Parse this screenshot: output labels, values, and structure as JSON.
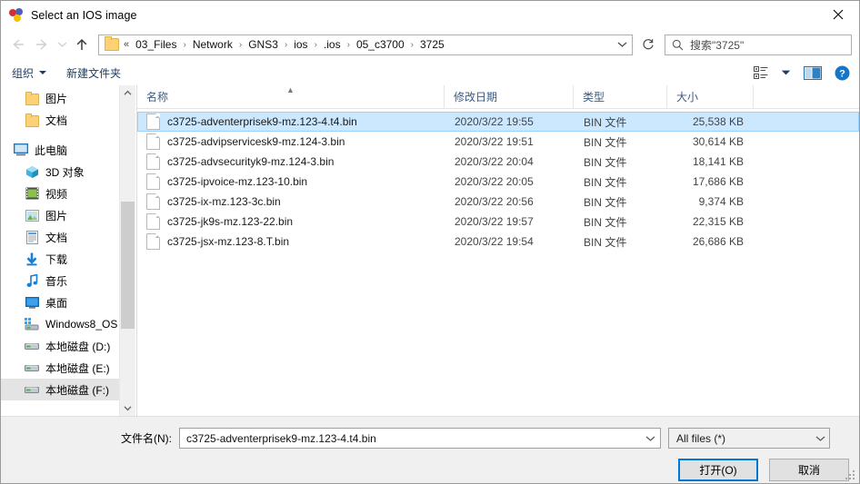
{
  "window": {
    "title": "Select an IOS image",
    "icon": "gns3-balls-icon",
    "close_label": "✕"
  },
  "nav": {
    "back_icon": "arrow-left-icon",
    "forward_icon": "arrow-right-icon",
    "recent_icon": "chevron-down-icon",
    "up_icon": "arrow-up-icon",
    "refresh_icon": "refresh-icon",
    "breadcrumb_prefix": "«",
    "breadcrumb": [
      "03_Files",
      "Network",
      "GNS3",
      "ios",
      ".ios",
      "05_c3700",
      "3725"
    ],
    "breadcrumb_separator": "›",
    "dropdown_icon": "chevron-down-icon"
  },
  "search": {
    "icon": "search-icon",
    "placeholder": "搜索\"3725\""
  },
  "toolbar": {
    "organize_label": "组织",
    "new_folder_label": "新建文件夹",
    "view_icon": "view-list-icon",
    "view_caret_icon": "chevron-down-icon",
    "preview_pane_icon": "preview-pane-icon",
    "help_icon": "help-icon"
  },
  "sidebar": {
    "items": [
      {
        "label": "图片",
        "icon": "folder-icon",
        "indent": true,
        "selected": false
      },
      {
        "label": "文档",
        "icon": "folder-icon",
        "indent": true,
        "selected": false
      },
      {
        "label": "",
        "icon": "spacer",
        "indent": false,
        "selected": false
      },
      {
        "label": "此电脑",
        "icon": "this-pc-icon",
        "indent": false,
        "selected": false
      },
      {
        "label": "3D 对象",
        "icon": "3d-objects-icon",
        "indent": true,
        "selected": false
      },
      {
        "label": "视频",
        "icon": "videos-icon",
        "indent": true,
        "selected": false
      },
      {
        "label": "图片",
        "icon": "pictures-icon",
        "indent": true,
        "selected": false
      },
      {
        "label": "文档",
        "icon": "documents-icon",
        "indent": true,
        "selected": false
      },
      {
        "label": "下载",
        "icon": "downloads-icon",
        "indent": true,
        "selected": false
      },
      {
        "label": "音乐",
        "icon": "music-icon",
        "indent": true,
        "selected": false
      },
      {
        "label": "桌面",
        "icon": "desktop-icon",
        "indent": true,
        "selected": false
      },
      {
        "label": "Windows8_OS",
        "icon": "system-drive-icon",
        "indent": true,
        "selected": false
      },
      {
        "label": "本地磁盘 (D:)",
        "icon": "drive-icon",
        "indent": true,
        "selected": false
      },
      {
        "label": "本地磁盘 (E:)",
        "icon": "drive-icon",
        "indent": true,
        "selected": false
      },
      {
        "label": "本地磁盘 (F:)",
        "icon": "drive-icon",
        "indent": true,
        "selected": true
      }
    ]
  },
  "filelist": {
    "columns": [
      {
        "label": "名称",
        "sorted": true,
        "sort_icon": "sort-ascending-caret"
      },
      {
        "label": "修改日期",
        "sorted": false
      },
      {
        "label": "类型",
        "sorted": false
      },
      {
        "label": "大小",
        "sorted": false
      }
    ],
    "rows": [
      {
        "name": "c3725-adventerprisek9-mz.123-4.t4.bin",
        "date": "2020/3/22 19:55",
        "type": "BIN 文件",
        "size": "25,538 KB",
        "selected": true
      },
      {
        "name": "c3725-advipservicesk9-mz.124-3.bin",
        "date": "2020/3/22 19:51",
        "type": "BIN 文件",
        "size": "30,614 KB",
        "selected": false
      },
      {
        "name": "c3725-advsecurityk9-mz.124-3.bin",
        "date": "2020/3/22 20:04",
        "type": "BIN 文件",
        "size": "18,141 KB",
        "selected": false
      },
      {
        "name": "c3725-ipvoice-mz.123-10.bin",
        "date": "2020/3/22 20:05",
        "type": "BIN 文件",
        "size": "17,686 KB",
        "selected": false
      },
      {
        "name": "c3725-ix-mz.123-3c.bin",
        "date": "2020/3/22 20:56",
        "type": "BIN 文件",
        "size": "9,374 KB",
        "selected": false
      },
      {
        "name": "c3725-jk9s-mz.123-22.bin",
        "date": "2020/3/22 19:57",
        "type": "BIN 文件",
        "size": "22,315 KB",
        "selected": false
      },
      {
        "name": "c3725-jsx-mz.123-8.T.bin",
        "date": "2020/3/22 19:54",
        "type": "BIN 文件",
        "size": "26,686 KB",
        "selected": false
      }
    ]
  },
  "footer": {
    "filename_label": "文件名(N):",
    "filename_value": "c3725-adventerprisek9-mz.123-4.t4.bin",
    "filename_dropdown_icon": "chevron-down-icon",
    "filter_value": "All files (*)",
    "filter_dropdown_icon": "chevron-down-icon",
    "open_label": "打开(O)",
    "cancel_label": "取消"
  },
  "colors": {
    "selection_fill": "#cce8ff",
    "selection_border": "#99d1ff",
    "accent": "#0078d7",
    "column_header_text": "#3c5a80",
    "toolbar_text": "#1f3c63",
    "footer_bg": "#f0f0f0"
  }
}
